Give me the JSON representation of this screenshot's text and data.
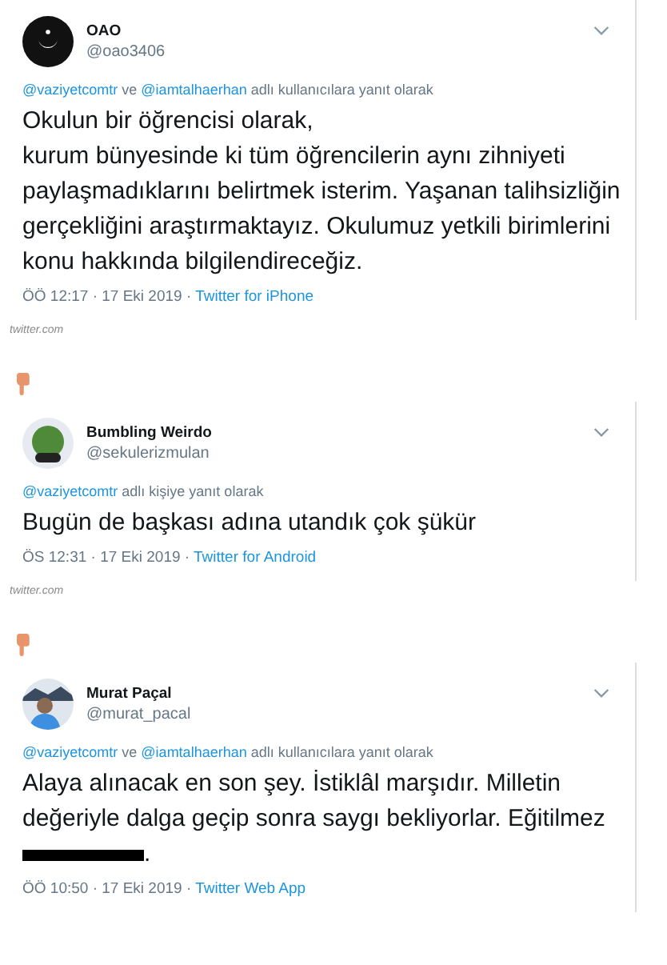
{
  "tweets": [
    {
      "name": "OAO",
      "handle": "@oao3406",
      "avatar": {
        "kind": "logo"
      },
      "reply": [
        {
          "text": "@vaziyetcomtr",
          "kind": "mention"
        },
        {
          "text": " ve ",
          "kind": "plain"
        },
        {
          "text": "@iamtalhaerhan",
          "kind": "mention"
        },
        {
          "text": " adlı kullanıcılara yanıt olarak",
          "kind": "plain"
        }
      ],
      "lines": [
        {
          "text": "Okulun bir öğrencisi olarak,",
          "redacted": false
        },
        {
          "text": "kurum bünyesinde ki tüm öğrencilerin aynı zihniyeti",
          "redacted": false
        },
        {
          "text": "paylaşmadıklarını belirtmek isterim. Yaşanan talihsizliğin",
          "redacted": false
        },
        {
          "text": "gerçekliğini araştırmaktayız. Okulumuz yetkili birimlerini",
          "redacted": false
        },
        {
          "text": "konu hakkında bilgilendireceğiz.",
          "redacted": false
        }
      ],
      "timestamp": "ÖÖ 12:17 · 17 Eki 2019 ·",
      "source": "Twitter for iPhone",
      "embed_source": "twitter.com"
    },
    {
      "name": "Bumbling Weirdo",
      "handle": "@sekulerizmulan",
      "avatar": {
        "kind": "cartoon"
      },
      "reply": [
        {
          "text": "@vaziyetcomtr",
          "kind": "mention"
        },
        {
          "text": " adlı kişiye yanıt olarak",
          "kind": "plain"
        }
      ],
      "lines": [
        {
          "text": "Bugün de başkası adına utandık çok şükür",
          "redacted": false
        }
      ],
      "timestamp": "ÖS 12:31 · 17 Eki 2019 ·",
      "source": "Twitter for Android",
      "embed_source": "twitter.com"
    },
    {
      "name": "Murat Paçal",
      "handle": "@murat_pacal",
      "avatar": {
        "kind": "photo"
      },
      "reply": [
        {
          "text": "@vaziyetcomtr",
          "kind": "mention"
        },
        {
          "text": " ve ",
          "kind": "plain"
        },
        {
          "text": "@iamtalhaerhan",
          "kind": "mention"
        },
        {
          "text": " adlı kullanıcılara yanıt olarak",
          "kind": "plain"
        }
      ],
      "lines": [
        {
          "text": "Alaya alınacak en son şey. İstiklâl marşıdır. Milletin",
          "redacted": false
        },
        {
          "text": "değeriyle dalga geçip sonra saygı bekliyorlar. Eğitilmez",
          "redacted": false
        },
        {
          "text": ".",
          "redacted": true
        }
      ],
      "timestamp": "ÖÖ 10:50 · 17 Eki 2019 ·",
      "source": "Twitter Web App"
    }
  ]
}
